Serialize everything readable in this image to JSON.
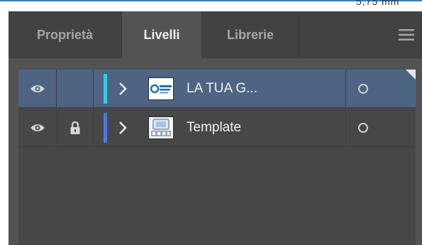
{
  "top_fragment": "5,75 mm",
  "tabs": [
    {
      "label": "Proprietà",
      "active": false
    },
    {
      "label": "Livelli",
      "active": true
    },
    {
      "label": "Librerie",
      "active": false
    }
  ],
  "icons": {
    "menu": "hamburger-menu-icon",
    "visibility": "eye-icon",
    "lock": "lock-icon",
    "expand": "chevron-right-icon",
    "target": "target-circle-icon"
  },
  "colors": {
    "accent_blue": "#2d7fd0",
    "panel_bg": "#535353",
    "tabbar_bg": "#424242",
    "selected_row": "#4d6482",
    "layer1_color": "#38c9e6",
    "layer2_color": "#4a78e8"
  },
  "layers": [
    {
      "name": "LA TUA G...",
      "visible": true,
      "locked": false,
      "selected": true,
      "color": "#38c9e6"
    },
    {
      "name": "Template",
      "visible": true,
      "locked": true,
      "selected": false,
      "color": "#4a78e8"
    }
  ]
}
